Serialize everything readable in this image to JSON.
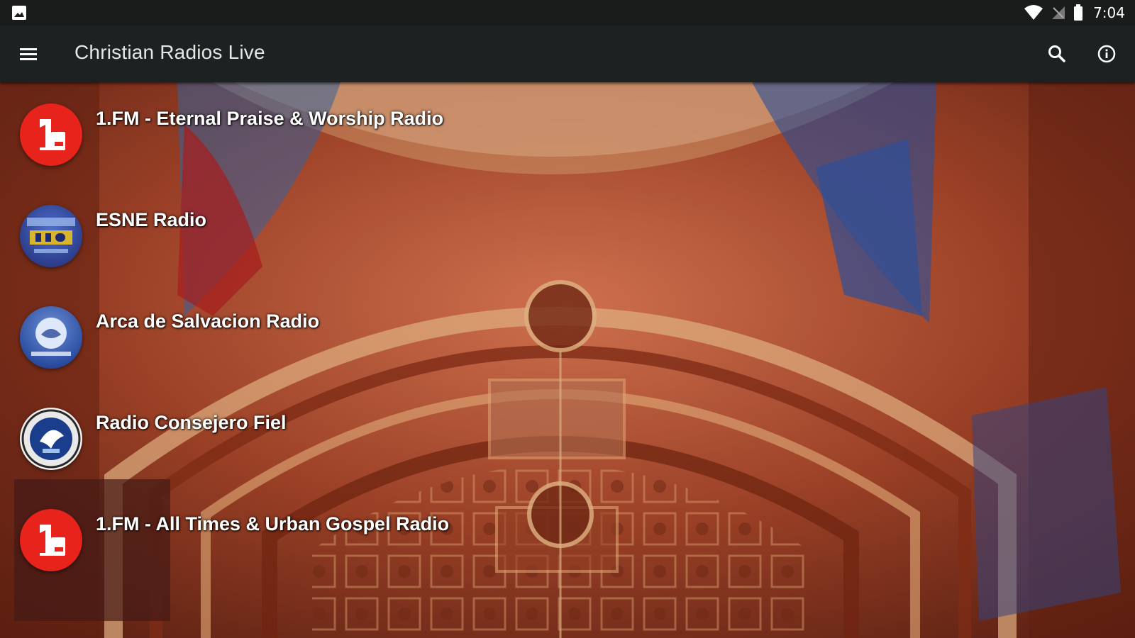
{
  "status_bar": {
    "time": "7:04",
    "icons": [
      "image-notification-icon",
      "wifi-icon",
      "signal-off-icon",
      "battery-icon"
    ]
  },
  "app_bar": {
    "title": "Christian Radios Live",
    "icons": [
      "menu-icon",
      "search-icon",
      "info-icon"
    ]
  },
  "stations": [
    {
      "name": "1.FM - Eternal Praise & Worship Radio",
      "logo": "onefm-logo",
      "logo_color": "#e8231c"
    },
    {
      "name": "ESNE Radio",
      "logo": "esne-logo",
      "logo_color": "#2b3f8f"
    },
    {
      "name": "Arca de Salvacion Radio",
      "logo": "arca-logo",
      "logo_color": "#1d4aa8"
    },
    {
      "name": "Radio Consejero Fiel",
      "logo": "consejero-logo",
      "logo_color": "#1a3e8c"
    },
    {
      "name": "1.FM - All Times & Urban Gospel Radio",
      "logo": "onefm-logo",
      "logo_color": "#e8231c"
    }
  ],
  "colors": {
    "status_bar": "#1a1c1c",
    "app_bar": "#1b2221",
    "background_tint": "#b5482e"
  }
}
